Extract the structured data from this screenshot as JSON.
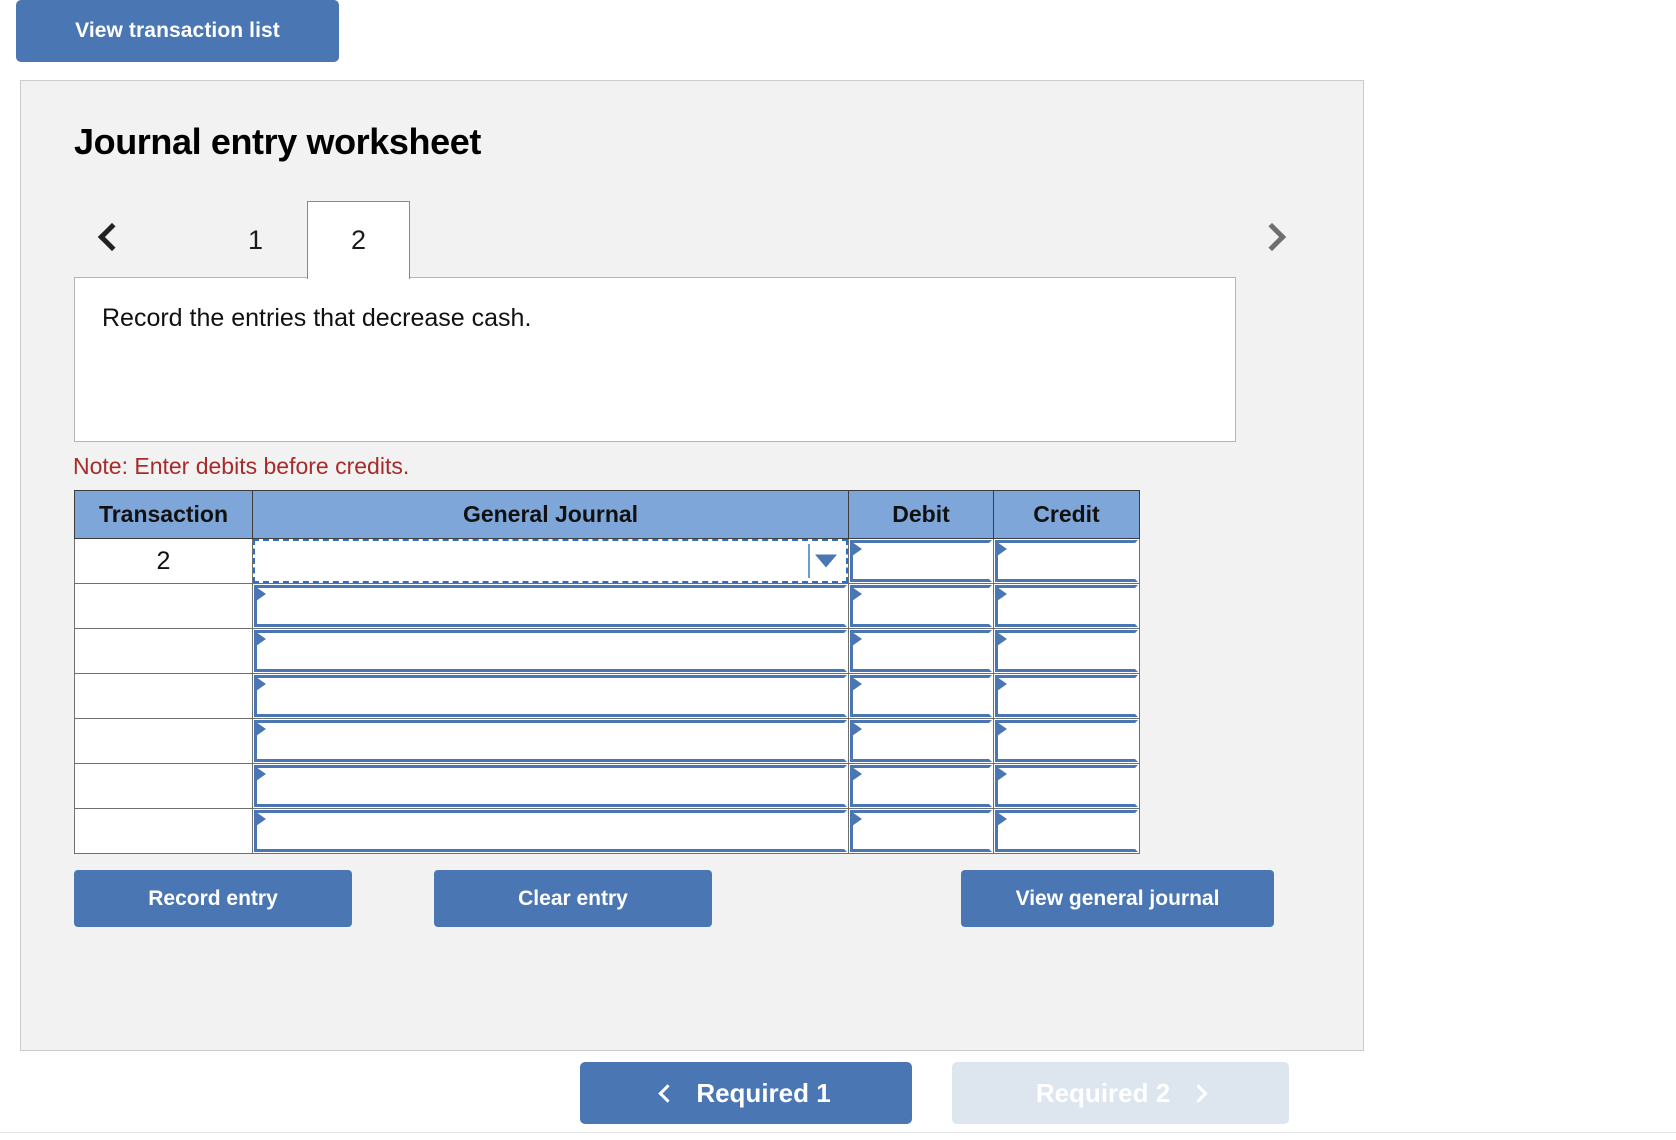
{
  "top_bar": {
    "view_transaction_list_label": "View transaction list"
  },
  "worksheet": {
    "title": "Journal entry worksheet",
    "tabs": [
      {
        "label": "1",
        "active": false
      },
      {
        "label": "2",
        "active": true
      }
    ],
    "prev_icon": "chevron-left-icon",
    "next_icon": "chevron-right-icon",
    "instruction": "Record the entries that decrease cash.",
    "note": "Note: Enter debits before credits.",
    "table": {
      "columns": [
        "Transaction",
        "General Journal",
        "Debit",
        "Credit"
      ],
      "rows": [
        {
          "transaction": "2",
          "general_journal": "",
          "debit": "",
          "credit": "",
          "focused": true
        },
        {
          "transaction": "",
          "general_journal": "",
          "debit": "",
          "credit": "",
          "focused": false
        },
        {
          "transaction": "",
          "general_journal": "",
          "debit": "",
          "credit": "",
          "focused": false
        },
        {
          "transaction": "",
          "general_journal": "",
          "debit": "",
          "credit": "",
          "focused": false
        },
        {
          "transaction": "",
          "general_journal": "",
          "debit": "",
          "credit": "",
          "focused": false
        },
        {
          "transaction": "",
          "general_journal": "",
          "debit": "",
          "credit": "",
          "focused": false
        },
        {
          "transaction": "",
          "general_journal": "",
          "debit": "",
          "credit": "",
          "focused": false
        }
      ]
    },
    "actions": {
      "record_entry_label": "Record entry",
      "clear_entry_label": "Clear entry",
      "view_general_journal_label": "View general journal"
    }
  },
  "footer": {
    "required_1_label": "Required 1",
    "required_2_label": "Required 2",
    "required_1_active": true,
    "required_2_active": false
  },
  "colors": {
    "primary_blue": "#4a77b4",
    "header_blue": "#7fa6d9",
    "panel_gray": "#f2f2f2",
    "note_red": "#a62b2b",
    "disabled_blue": "#dde5ee"
  }
}
